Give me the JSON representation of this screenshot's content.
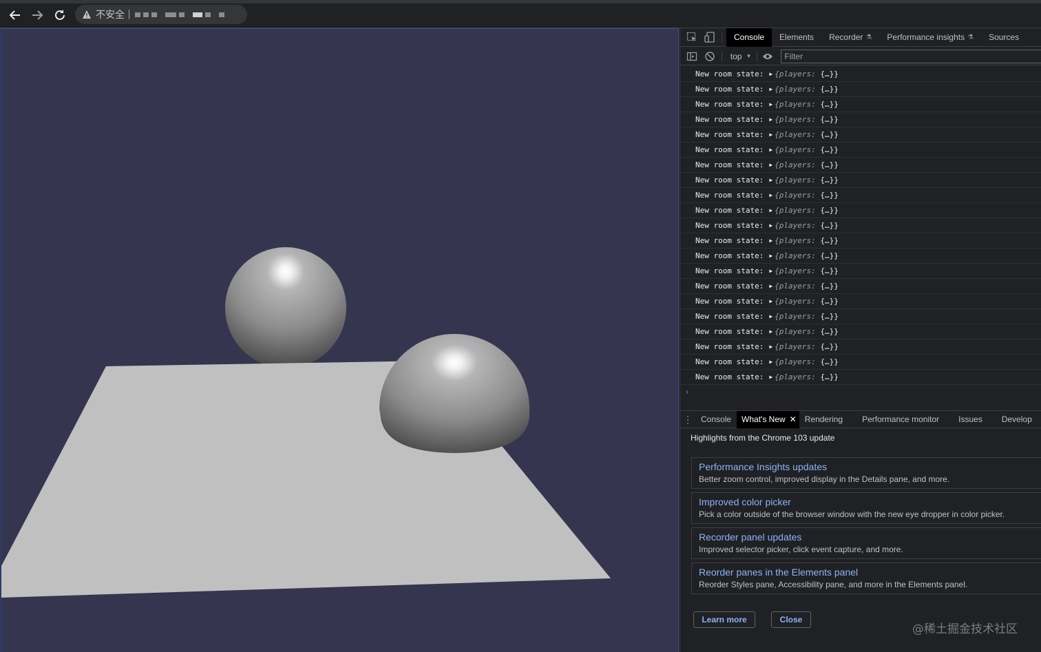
{
  "browser": {
    "security_label": "不安全",
    "icons": [
      "back-icon",
      "forward-icon",
      "reload-icon",
      "warning-icon"
    ]
  },
  "scene": {
    "background_color": "#36354f",
    "plane_color": "#c0c0c0",
    "sphere_color": "#8f8f8f"
  },
  "devtools": {
    "tabs": [
      {
        "label": "Console",
        "active": true
      },
      {
        "label": "Elements"
      },
      {
        "label": "Recorder",
        "experimental": true
      },
      {
        "label": "Performance insights",
        "experimental": true
      },
      {
        "label": "Sources"
      }
    ],
    "context": "top",
    "filter_placeholder": "Filter",
    "log_message": "New room state:",
    "log_object_key": "{players:",
    "log_object_val": "{…}}",
    "log_count": 21,
    "drawer_tabs": [
      {
        "label": "Console"
      },
      {
        "label": "What's New",
        "active": true
      },
      {
        "label": "Rendering"
      },
      {
        "label": "Performance monitor"
      },
      {
        "label": "Issues"
      },
      {
        "label": "Develop"
      }
    ],
    "whats_new": {
      "heading": "Highlights from the Chrome 103 update",
      "cards": [
        {
          "title": "Performance Insights updates",
          "desc": "Better zoom control, improved display in the Details pane, and more."
        },
        {
          "title": "Improved color picker",
          "desc": "Pick a color outside of the browser window with the new eye dropper in color picker."
        },
        {
          "title": "Recorder panel updates",
          "desc": "Improved selector picker, click event capture, and more."
        },
        {
          "title": "Reorder panes in the Elements panel",
          "desc": "Reorder Styles pane, Accessibility pane, and more in the Elements panel."
        }
      ],
      "learn_more": "Learn more",
      "close": "Close"
    },
    "watermark": "@稀土掘金技术社区"
  }
}
